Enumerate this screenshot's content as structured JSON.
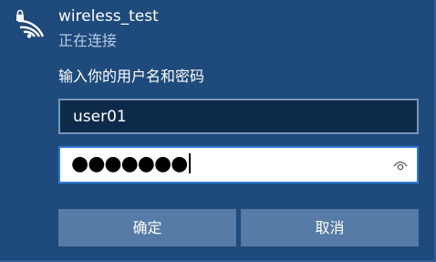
{
  "network": {
    "name": "wireless_test",
    "status": "正在连接",
    "icon": "wifi-secured-icon"
  },
  "credentials": {
    "prompt": "输入你的用户名和密码",
    "username_value": "user01",
    "password_masked": "●●●●●●●",
    "reveal_icon": "eye-icon"
  },
  "buttons": {
    "ok_label": "确定",
    "cancel_label": "取消"
  },
  "colors": {
    "panel_bg": "#1e4a7c",
    "field_dark_bg": "#0d2a4a",
    "field_focus_border": "#2d7bd3",
    "button_bg": "#557ba6"
  }
}
